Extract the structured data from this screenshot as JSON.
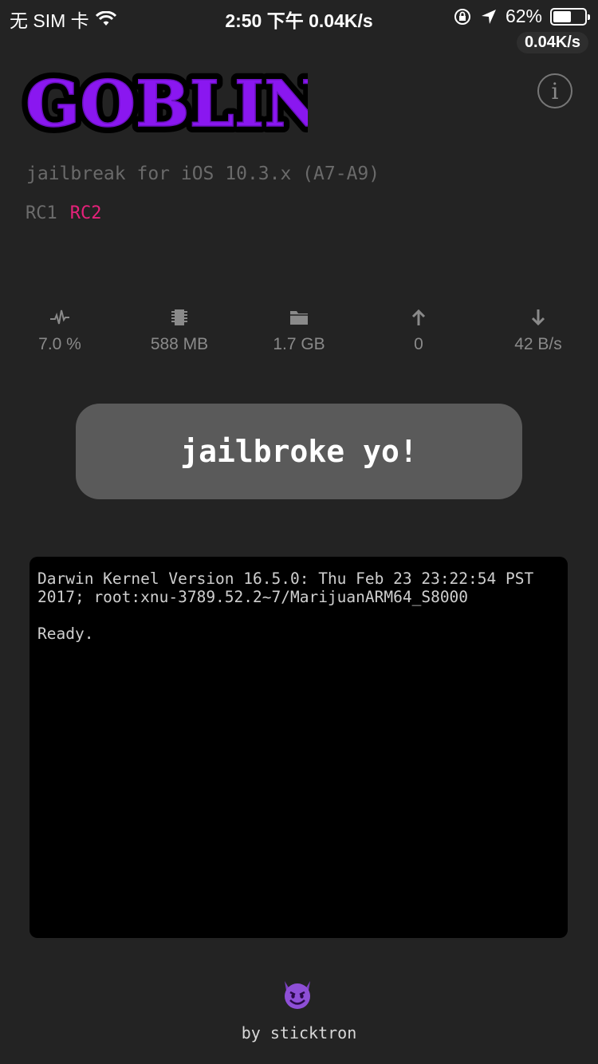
{
  "status_bar": {
    "carrier": "无 SIM 卡",
    "time_speed": "2:50 下午 0.04K/s",
    "battery_text": "62%",
    "battery_level": 0.62,
    "speed_badge": "0.04K/s"
  },
  "header": {
    "logo_text": "GOBLIN",
    "subtitle": "jailbreak for iOS 10.3.x (A7-A9)",
    "versions": [
      "RC1",
      "RC2"
    ],
    "active_version_color": "#e6217a",
    "info_label": "i"
  },
  "stats": [
    {
      "icon": "activity-icon",
      "value": "7.0 %"
    },
    {
      "icon": "memory-chip-icon",
      "value": "588 MB"
    },
    {
      "icon": "folder-icon",
      "value": "1.7 GB"
    },
    {
      "icon": "arrow-up-icon",
      "value": "0"
    },
    {
      "icon": "arrow-down-icon",
      "value": "42 B/s"
    }
  ],
  "action": {
    "label": "jailbroke yo!"
  },
  "console": {
    "text": "Darwin Kernel Version 16.5.0: Thu Feb 23 23:22:54 PST 2017; root:xnu-3789.52.2~7/MarijuanARM64_S8000\n\nReady."
  },
  "footer": {
    "emoji": "devil-emoji-icon",
    "credit": "by sticktron"
  },
  "colors": {
    "background": "#232323",
    "logo_fill": "#8a17f0",
    "button_bg": "#5a5a5a",
    "console_bg": "#000000"
  }
}
